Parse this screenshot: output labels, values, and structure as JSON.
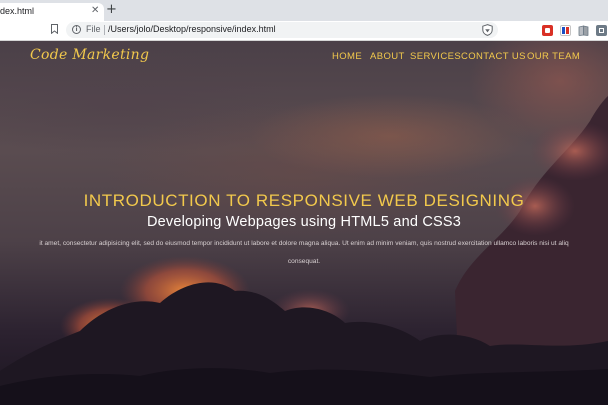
{
  "browser": {
    "tab": {
      "title": "dex.html",
      "close_glyph": "✕"
    },
    "new_tab_glyph": "+",
    "address_bar": {
      "scheme_label": "File",
      "url": "/Users/jolo/Desktop/responsive/index.html",
      "info_glyph": "i"
    },
    "icons": [
      "bookmark-icon",
      "info-icon",
      "shield-icon",
      "extension-icons"
    ]
  },
  "site": {
    "logo": "Code Marketing",
    "nav": [
      "HOME",
      "ABOUT",
      "SERVICES",
      "CONTACT US",
      "OUR TEAM"
    ],
    "hero": {
      "title": "INTRODUCTION TO RESPONSIVE WEB DESIGNING",
      "subtitle": "Developing Webpages using HTML5 and CSS3",
      "text_line_1": "it amet, consectetur adipisicing elit, sed do eiusmod tempor incididunt ut labore et dolore magna aliqua. Ut enim ad minim veniam, quis nostrud exercitation ullamco laboris nisi ut aliq",
      "text_line_2": "consequat."
    }
  },
  "colors": {
    "accent": "#f2c94c",
    "hero_text": "#ffffff",
    "tab_bar": "#dee1e6"
  }
}
